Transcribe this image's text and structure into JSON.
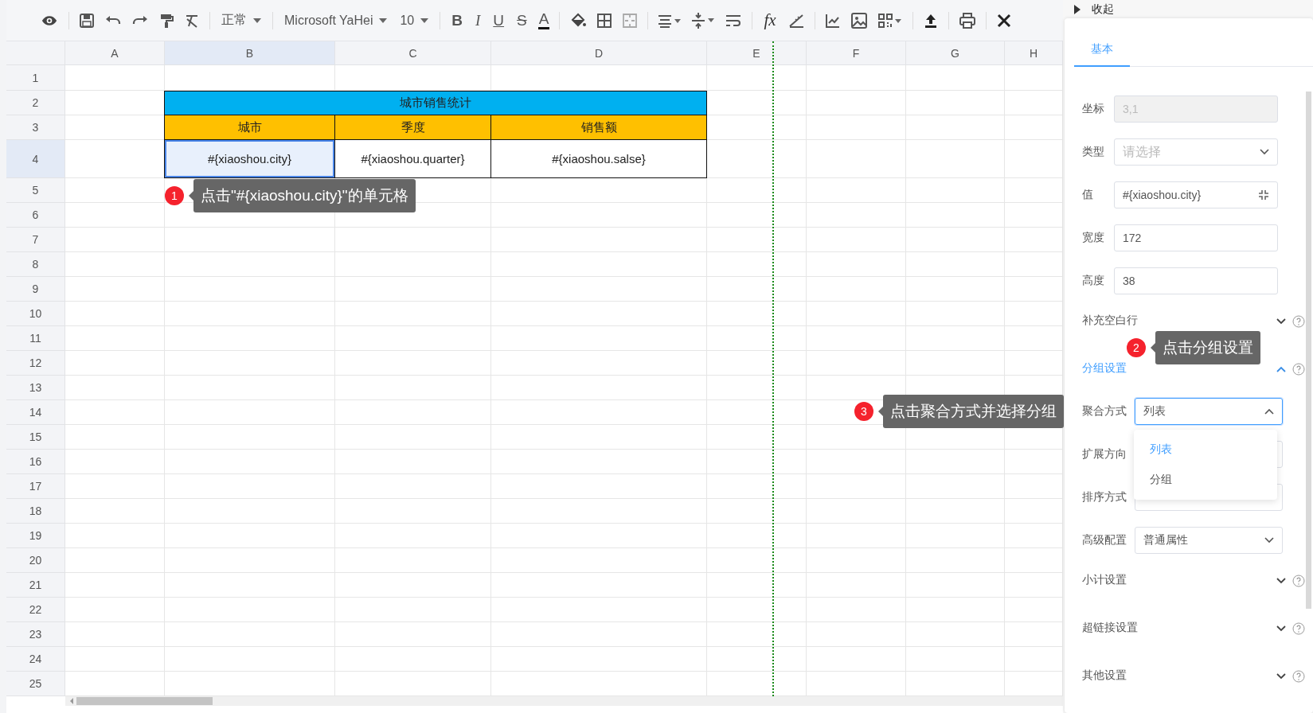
{
  "toolbar": {
    "style_select": "正常",
    "font_select": "Microsoft YaHei",
    "size_select": "10",
    "format_buttons": [
      {
        "label": "B",
        "kind": "bold"
      },
      {
        "label": "I",
        "kind": "italic"
      },
      {
        "label": "U",
        "kind": "underline"
      },
      {
        "label": "S",
        "kind": "strike"
      },
      {
        "label": "A",
        "kind": "color"
      }
    ],
    "formula_button": "fx"
  },
  "sheet": {
    "columns": [
      {
        "label": "A",
        "selected": false
      },
      {
        "label": "B",
        "selected": true
      },
      {
        "label": "C",
        "selected": false
      },
      {
        "label": "D",
        "selected": false
      },
      {
        "label": "E",
        "selected": false
      },
      {
        "label": "F",
        "selected": false
      },
      {
        "label": "G",
        "selected": false
      },
      {
        "label": "H",
        "selected": false
      }
    ],
    "rows": [
      {
        "label": "1",
        "selected": false
      },
      {
        "label": "2",
        "selected": false
      },
      {
        "label": "3",
        "selected": false
      },
      {
        "label": "4",
        "selected": true
      },
      {
        "label": "5",
        "selected": false
      },
      {
        "label": "6",
        "selected": false
      },
      {
        "label": "7",
        "selected": false
      },
      {
        "label": "8",
        "selected": false
      },
      {
        "label": "9",
        "selected": false
      },
      {
        "label": "10",
        "selected": false
      },
      {
        "label": "11",
        "selected": false
      },
      {
        "label": "12",
        "selected": false
      },
      {
        "label": "13",
        "selected": false
      },
      {
        "label": "14",
        "selected": false
      },
      {
        "label": "15",
        "selected": false
      },
      {
        "label": "16",
        "selected": false
      },
      {
        "label": "17",
        "selected": false
      },
      {
        "label": "18",
        "selected": false
      },
      {
        "label": "19",
        "selected": false
      },
      {
        "label": "20",
        "selected": false
      },
      {
        "label": "21",
        "selected": false
      },
      {
        "label": "22",
        "selected": false
      },
      {
        "label": "23",
        "selected": false
      },
      {
        "label": "24",
        "selected": false
      },
      {
        "label": "25",
        "selected": false
      }
    ],
    "report": {
      "title": "城市销售统计",
      "headers": [
        "城市",
        "季度",
        "销售额"
      ],
      "cells": [
        {
          "text": "#{xiaoshou.city}",
          "selected": true
        },
        {
          "text": "#{xiaoshou.quarter}",
          "selected": false
        },
        {
          "text": "#{xiaoshou.salse}",
          "selected": false
        }
      ]
    }
  },
  "callouts": [
    {
      "number": "1",
      "text": "点击\"#{xiaoshou.city}\"的单元格"
    },
    {
      "number": "2",
      "text": "点击分组设置"
    },
    {
      "number": "3",
      "text": "点击聚合方式并选择分组"
    }
  ],
  "panel": {
    "collapse": "收起",
    "tabs": [
      {
        "label": "基本",
        "selected": true
      }
    ],
    "fields": [
      {
        "kind": "input",
        "label": "坐标",
        "value": "3,1",
        "disabled": true
      },
      {
        "kind": "select",
        "label": "类型",
        "placeholder": "请选择"
      },
      {
        "kind": "expression",
        "label": "值",
        "value": "#{xiaoshou.city}"
      },
      {
        "kind": "input",
        "label": "宽度",
        "value": "172",
        "disabled": false
      },
      {
        "kind": "input",
        "label": "高度",
        "value": "38",
        "disabled": false
      },
      {
        "kind": "section",
        "label": "补充空白行",
        "expanded": false
      },
      {
        "kind": "section",
        "label": "分组设置",
        "expanded": true
      },
      {
        "kind": "select",
        "label": "聚合方式",
        "value": "列表",
        "open": true,
        "options": [
          {
            "label": "列表",
            "selected": true
          },
          {
            "label": "分组",
            "selected": false
          }
        ]
      },
      {
        "kind": "select",
        "label": "扩展方向"
      },
      {
        "kind": "select",
        "label": "排序方式"
      },
      {
        "kind": "select",
        "label": "高级配置",
        "value": "普通属性"
      },
      {
        "kind": "section",
        "label": "小计设置",
        "expanded": false
      },
      {
        "kind": "section",
        "label": "超链接设置",
        "expanded": false
      },
      {
        "kind": "section",
        "label": "其他设置",
        "expanded": false
      }
    ]
  }
}
